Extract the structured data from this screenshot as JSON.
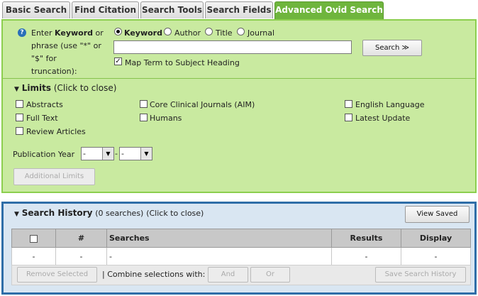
{
  "tabs": [
    {
      "label": "Basic Search"
    },
    {
      "label": "Find Citation"
    },
    {
      "label": "Search Tools"
    },
    {
      "label": "Search Fields"
    },
    {
      "label": "Advanced Ovid Search"
    }
  ],
  "search": {
    "help_icon": "?",
    "prompt_line1_prefix": "Enter ",
    "prompt_keyword": "Keyword",
    "prompt_line1_suffix": " or",
    "prompt_line2": "phrase (use \"*\" or",
    "prompt_line3": "\"$\" for",
    "prompt_line4": "truncation):",
    "radio_options": [
      {
        "label": "Keyword",
        "selected": true
      },
      {
        "label": "Author",
        "selected": false
      },
      {
        "label": "Title",
        "selected": false
      },
      {
        "label": "Journal",
        "selected": false
      }
    ],
    "input_value": "",
    "search_button": "Search ≫",
    "map_term_label": "Map Term to Subject Heading",
    "map_term_checked": true
  },
  "limits": {
    "title": "Limits",
    "hint": "(Click to close)",
    "col1": [
      "Abstracts",
      "Full Text",
      "Review Articles"
    ],
    "col2": [
      "Core Clinical Journals (AIM)",
      "Humans"
    ],
    "col3": [
      "English Language",
      "Latest Update"
    ],
    "pub_year_label": "Publication Year",
    "year_from": "-",
    "year_dash": "-",
    "year_to": "-",
    "additional_limits": "Additional Limits"
  },
  "history": {
    "title": "Search History",
    "count": "(0 searches)",
    "hint": "(Click to close)",
    "view_saved": "View Saved",
    "columns": {
      "num": "#",
      "searches": "Searches",
      "results": "Results",
      "display": "Display"
    },
    "row": {
      "select": "-",
      "num": "-",
      "searches": "-",
      "results": "-",
      "display": "-"
    },
    "remove_selected": "Remove Selected",
    "combine_label": "| Combine selections with:",
    "and_button": "And",
    "or_button": "Or",
    "save_history": "Save Search History"
  },
  "colors": {
    "panel_green": "#c9eaa0",
    "active_tab": "#6fb53d",
    "history_border": "#2f6ea8",
    "history_bg": "#d9e6f2"
  }
}
